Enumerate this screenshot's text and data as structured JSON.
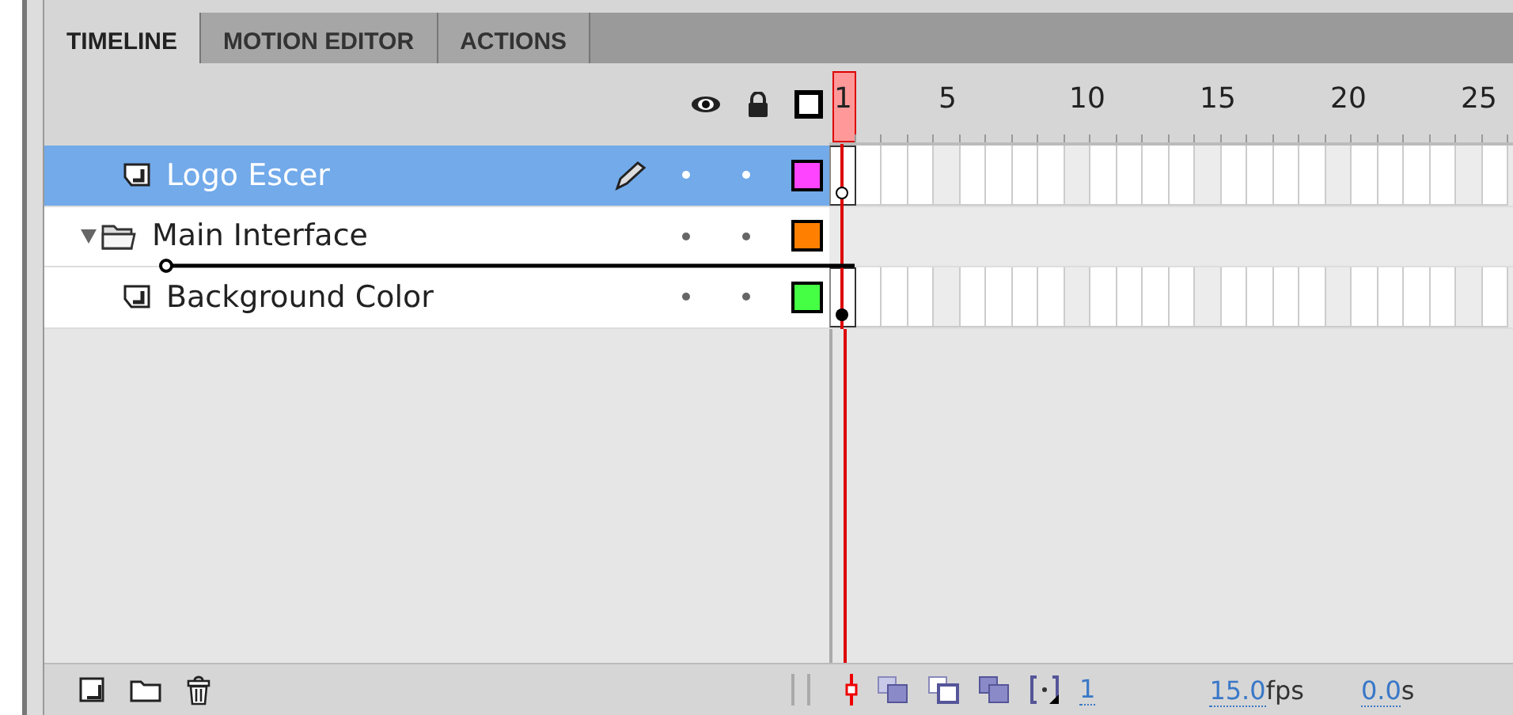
{
  "tabs": [
    {
      "label": "TIMELINE",
      "selected": true
    },
    {
      "label": "MOTION EDITOR",
      "selected": false
    },
    {
      "label": "ACTIONS",
      "selected": false
    }
  ],
  "frame_numbers": [
    "1",
    "5",
    "10",
    "15",
    "20",
    "25"
  ],
  "layers": [
    {
      "name": "Logo Escer",
      "kind": "layer",
      "selected": true,
      "editing": true,
      "color": "#ff44ff",
      "keyframe_filled": false
    },
    {
      "name": "Main Interface",
      "kind": "folder",
      "selected": false,
      "editing": false,
      "expanded": true,
      "color": "#ff8000"
    },
    {
      "name": "Background Color",
      "kind": "layer",
      "selected": false,
      "editing": false,
      "color": "#44ff44",
      "keyframe_filled": true,
      "drop_indicator": true
    }
  ],
  "status_bar": {
    "current_frame": "1",
    "frame_rate": "15.0",
    "frame_rate_unit": "fps",
    "elapsed_time": "0.0",
    "elapsed_time_unit": "s"
  }
}
